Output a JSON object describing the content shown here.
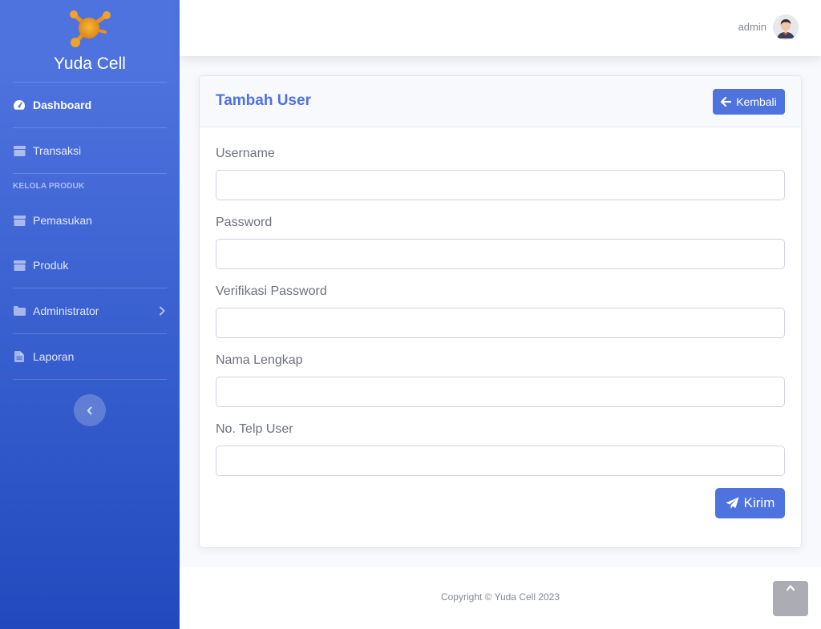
{
  "brand": {
    "name": "Yuda Cell",
    "logo_icon": "molecule-logo"
  },
  "sidebar": {
    "items": [
      {
        "label": "Dashboard",
        "icon": "tachometer-icon",
        "active": true
      },
      {
        "label": "Transaksi",
        "icon": "box-icon"
      },
      {
        "label": "Pemasukan",
        "icon": "box-icon"
      },
      {
        "label": "Produk",
        "icon": "box-icon"
      },
      {
        "label": "Administrator",
        "icon": "folder-icon",
        "has_submenu": true
      },
      {
        "label": "Laporan",
        "icon": "file-icon"
      }
    ],
    "heading_produk": "KELOLA PRODUK",
    "toggle_icon": "chevron-left-icon"
  },
  "topbar": {
    "user_name": "admin",
    "avatar_icon": "user-avatar"
  },
  "card": {
    "title": "Tambah User",
    "back_label": "Kembali",
    "fields": [
      {
        "label": "Username",
        "value": "",
        "type": "text"
      },
      {
        "label": "Password",
        "value": "",
        "type": "password"
      },
      {
        "label": "Verifikasi Password",
        "value": "",
        "type": "password"
      },
      {
        "label": "Nama Lengkap",
        "value": "",
        "type": "text"
      },
      {
        "label": "No. Telp User",
        "value": "",
        "type": "text"
      }
    ],
    "submit_label": "Kirim"
  },
  "footer": {
    "copyright": "Copyright © Yuda Cell 2023"
  },
  "colors": {
    "primary": "#4e73df",
    "primary_dark": "#224abe",
    "text_muted": "#858796"
  }
}
